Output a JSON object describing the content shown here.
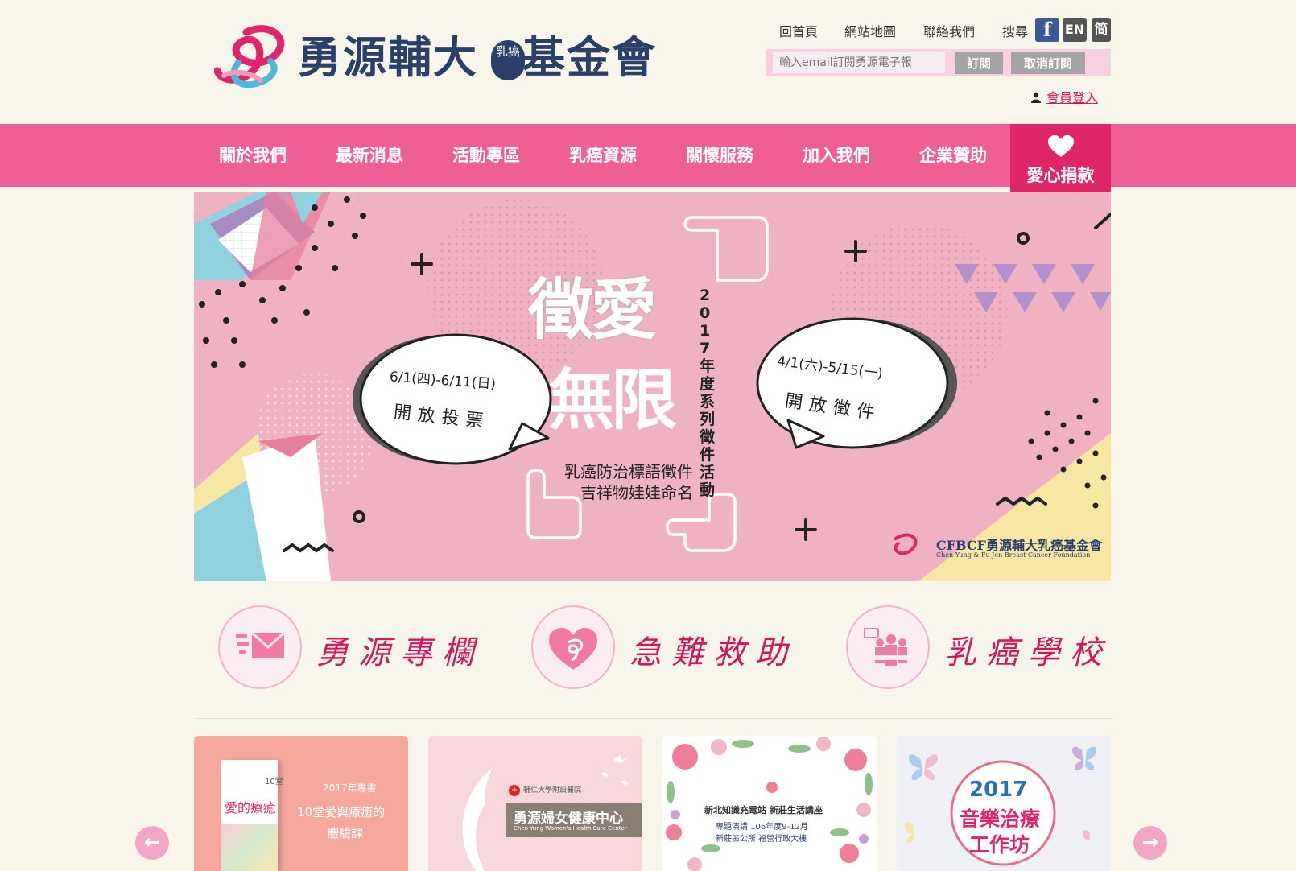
{
  "header": {
    "logo_text_1": "勇源輔大",
    "logo_badge": "乳癌",
    "logo_text_2": "基金會",
    "links": [
      "回首頁",
      "網站地圖",
      "聯絡我們",
      "搜尋"
    ],
    "social": {
      "facebook": "f",
      "english": "EN",
      "simplified": "简"
    },
    "subscribe": {
      "placeholder": "輸入email訂閱勇源電子報",
      "subscribe_label": "訂閱",
      "unsubscribe_label": "取消訂閱"
    },
    "member_login": "會員登入"
  },
  "nav": {
    "items": [
      "關於我們",
      "最新消息",
      "活動專區",
      "乳癌資源",
      "關懷服務",
      "加入我們",
      "企業贊助"
    ],
    "donate": "愛心捐款"
  },
  "banner": {
    "title_1": "徵愛",
    "title_2": "無限",
    "subtitle_1": "乳癌防治標語徵件",
    "subtitle_2": "吉祥物娃娃命名",
    "vertical_text": "2017年度系列徵件活動",
    "left_bubble_date": "6/1(四)-6/11(日)",
    "left_bubble_text": "開放投票",
    "right_bubble_date": "4/1(六)-5/15(一)",
    "right_bubble_text": "開放徵件",
    "org_name": "CFBCF勇源輔大乳癌基金會",
    "org_english": "Chen Yung & Fu Jen Breast Cancer Foundation"
  },
  "features": [
    {
      "label": "勇源專欄",
      "icon": "envelope-icon"
    },
    {
      "label": "急難救助",
      "icon": "heart-ribbon-icon"
    },
    {
      "label": "乳癌學校",
      "icon": "people-chat-icon"
    }
  ],
  "cards": {
    "card1": {
      "book_title": "愛的療癒",
      "book_side": "10堂",
      "year": "2017年專書",
      "line1": "10堂愛與療癒的",
      "line2": "體驗課"
    },
    "card2": {
      "hospital": "輔仁大學附設醫院",
      "center": "勇源婦女健康中心",
      "center_en": "Chen Yung Women's Health Care Center"
    },
    "card3": {
      "title": "新北知識充電站 新莊生活講座",
      "line1": "專題演講 106年度9-12月",
      "line2": "新莊區公所 福營行政大樓"
    },
    "card4": {
      "year": "2017",
      "line1": "音樂治療",
      "line2": "工作坊"
    }
  },
  "carousel": {
    "prev": "←",
    "next": "→"
  },
  "colors": {
    "brand_pink": "#ee5f95",
    "donate_pink": "#e0266b",
    "navy": "#2b3f6b",
    "page_bg": "#f8f6ea",
    "banner_bg": "#efb2c2"
  }
}
